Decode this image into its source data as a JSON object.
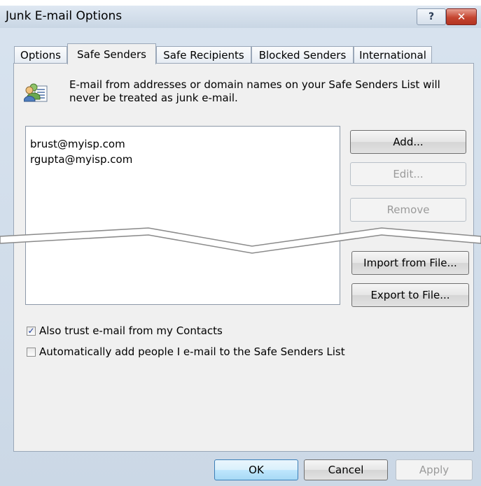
{
  "window": {
    "title": "Junk E-mail Options",
    "help_glyph": "?",
    "close_glyph": "✕"
  },
  "tabs": [
    {
      "label": "Options"
    },
    {
      "label": "Safe Senders"
    },
    {
      "label": "Safe Recipients"
    },
    {
      "label": "Blocked Senders"
    },
    {
      "label": "International"
    }
  ],
  "info": {
    "text": "E-mail from addresses or domain names on your Safe Senders List will never be treated as junk e-mail."
  },
  "list": {
    "items": [
      "brust@myisp.com",
      "rgupta@myisp.com"
    ]
  },
  "buttons": {
    "add": "Add...",
    "edit": "Edit...",
    "remove": "Remove",
    "import": "Import from File...",
    "export": "Export to File..."
  },
  "checkboxes": [
    {
      "label": "Also trust e-mail from my Contacts",
      "checked": true
    },
    {
      "label": "Automatically add people I e-mail to the Safe Senders List",
      "checked": false
    }
  ],
  "footer": {
    "ok": "OK",
    "cancel": "Cancel",
    "apply": "Apply"
  }
}
